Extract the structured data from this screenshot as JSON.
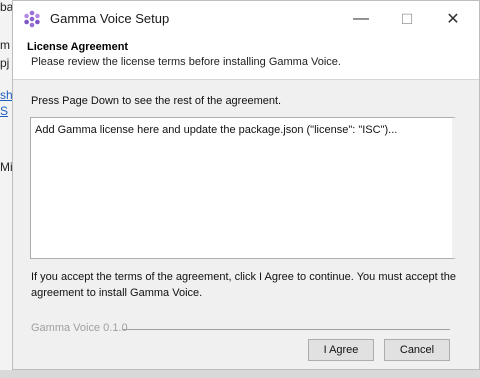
{
  "background": {
    "fragments": [
      "ba",
      "m",
      "pj",
      "sh",
      "S",
      "Mi"
    ]
  },
  "window": {
    "title": "Gamma Voice Setup",
    "icon": "gamma-logo-icon",
    "controls": {
      "minimize": "—",
      "maximize": "☐",
      "close": "✕"
    }
  },
  "header": {
    "title": "License Agreement",
    "subtitle": "Please review the license terms before installing Gamma Voice."
  },
  "body": {
    "instruction": "Press Page Down to see the rest of the agreement.",
    "license_text": "Add Gamma license here and update the package.json (\"license\": \"ISC\")...",
    "accept_text": "If you accept the terms of the agreement, click I Agree to continue. You must accept the agreement to install Gamma Voice."
  },
  "footer": {
    "branding": "Gamma Voice 0.1.0",
    "agree_label": "I Agree",
    "cancel_label": "Cancel"
  },
  "colors": {
    "accent": "#8a63c9",
    "window_bg": "#f0f0f0",
    "header_bg": "#ffffff"
  }
}
